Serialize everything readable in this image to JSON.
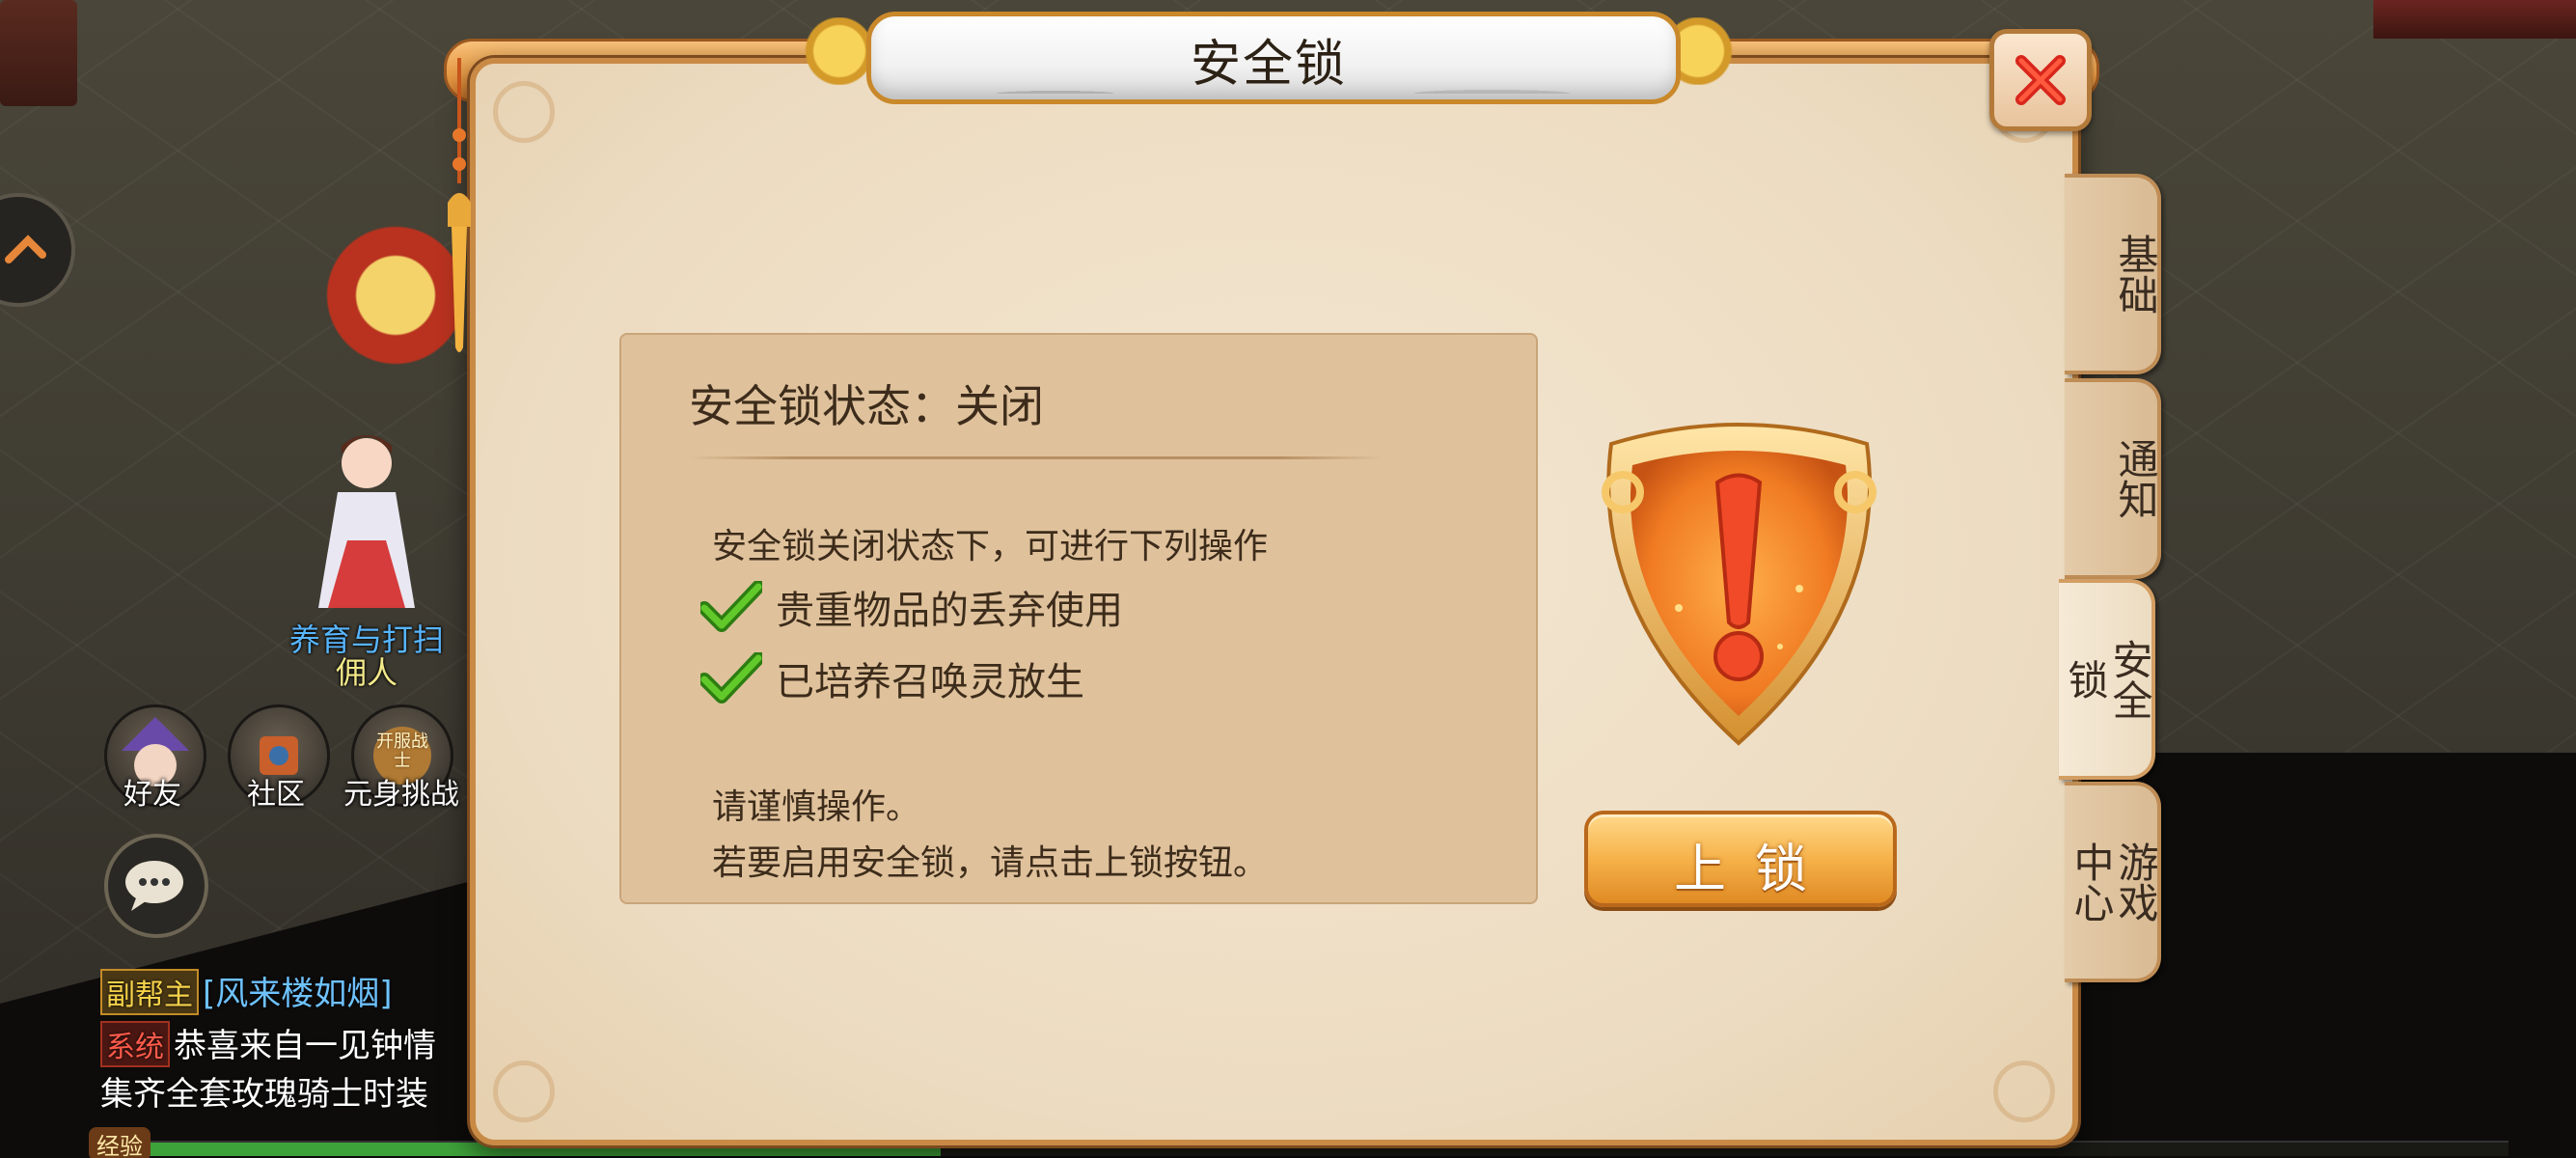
{
  "dialog": {
    "title": "安全锁",
    "close_label": "close"
  },
  "status": {
    "title": "安全锁状态：关闭",
    "description": "安全锁关闭状态下，可进行下列操作",
    "items": [
      {
        "label": "贵重物品的丢弃使用"
      },
      {
        "label": "已培养召唤灵放生"
      }
    ],
    "caution_line1": "请谨慎操作。",
    "caution_line2": "若要启用安全锁，请点击上锁按钮。"
  },
  "lock_button": {
    "label": "上锁"
  },
  "side_tabs": [
    {
      "label": "基础",
      "active": false
    },
    {
      "label": "通知",
      "active": false
    },
    {
      "label": "安全锁",
      "active": true
    },
    {
      "label": "游戏中心",
      "active": false
    }
  ],
  "game_hud": {
    "npc_name_line1": "养育与打扫",
    "npc_name_line2": "佣人",
    "icons": [
      {
        "label": "好友",
        "icon": "friends-icon"
      },
      {
        "label": "社区",
        "icon": "community-icon"
      },
      {
        "label": "元身挑战",
        "icon": "challenge-icon",
        "badge": "开服战士"
      }
    ],
    "chat": [
      {
        "tag": "副帮主",
        "text": "[风来楼如烟]"
      },
      {
        "tag": "系统",
        "text": "恭喜来自一见钟情"
      },
      {
        "tag": "",
        "text": "集齐全套玫瑰骑士时装"
      }
    ],
    "exp_label": "经验"
  },
  "colors": {
    "accent_orange": "#e89a44",
    "panel_bg": "#ecdbc0",
    "text_dark": "#3d2c1b",
    "check_green": "#4caf1a"
  }
}
